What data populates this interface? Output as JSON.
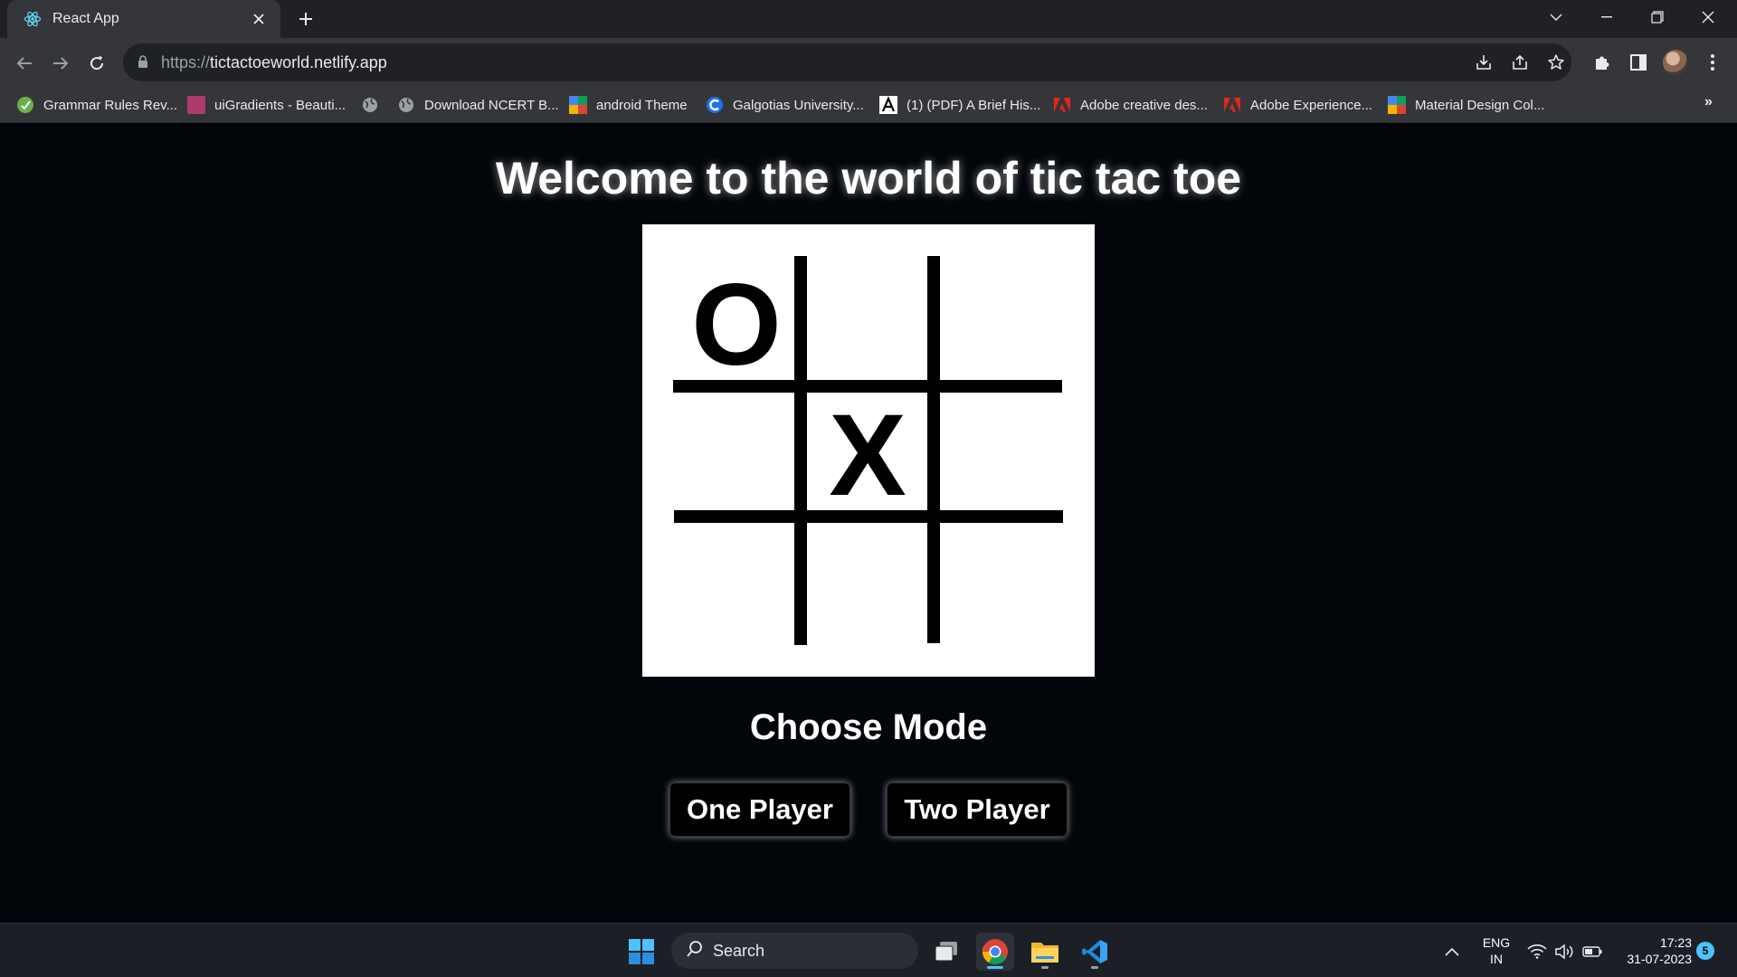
{
  "browser": {
    "tab": {
      "title": "React App"
    },
    "url": {
      "scheme": "https://",
      "host": "tictactoeworld.netlify.app"
    },
    "bookmarks": [
      {
        "label": "Grammar Rules Rev...",
        "icon": "grammar-favicon",
        "color": "#6ab04c"
      },
      {
        "label": "uiGradients - Beauti...",
        "icon": "uigradients-favicon",
        "color": "#b03a6e"
      },
      {
        "label": "",
        "icon": "globe-favicon",
        "color": "#9aa0a6"
      },
      {
        "label": "Download NCERT B...",
        "icon": "globe-favicon",
        "color": "#9aa0a6"
      },
      {
        "label": "android Theme",
        "icon": "color-tiles-favicon",
        "color": "#4285f4"
      },
      {
        "label": "Galgotias University...",
        "icon": "galgotias-favicon",
        "color": "#1a73e8"
      },
      {
        "label": "(1) (PDF) A Brief His...",
        "icon": "academia-favicon",
        "color": "#ffffff"
      },
      {
        "label": "Adobe creative des...",
        "icon": "adobe-favicon",
        "color": "#e1251b"
      },
      {
        "label": "Adobe Experience...",
        "icon": "adobe-favicon",
        "color": "#e1251b"
      },
      {
        "label": "Material Design Col...",
        "icon": "color-tiles-favicon",
        "color": "#4285f4"
      }
    ],
    "more_bookmarks": "»"
  },
  "page": {
    "headline": "Welcome to the world of tic tac toe",
    "board_marks": {
      "o": "O",
      "x": "X"
    },
    "mode_title": "Choose Mode",
    "buttons": {
      "one_player": "One Player",
      "two_player": "Two Player"
    }
  },
  "taskbar": {
    "search_label": "Search",
    "language": {
      "line1": "ENG",
      "line2": "IN"
    },
    "time": "17:23",
    "date": "31-07-2023",
    "notifications": "5"
  }
}
